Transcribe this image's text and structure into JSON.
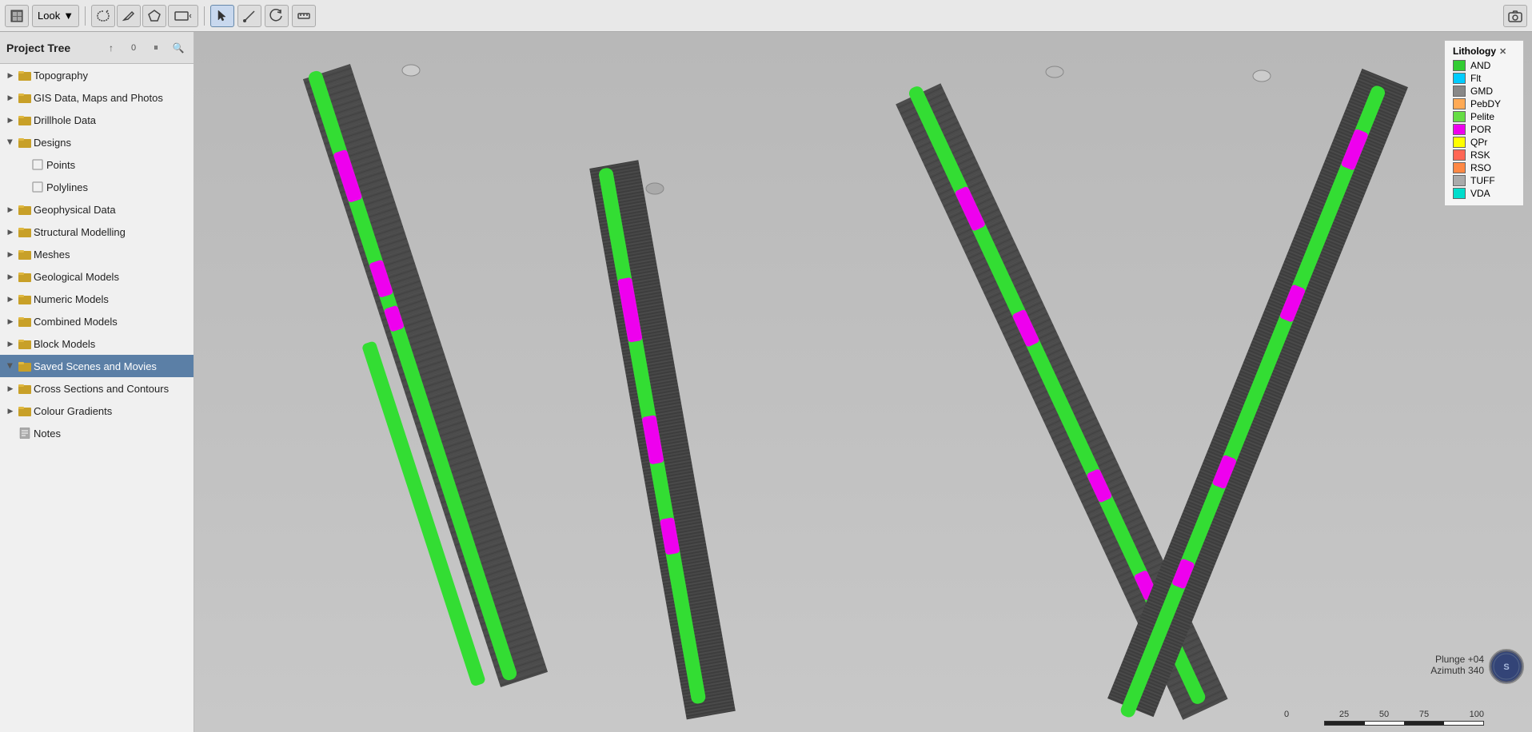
{
  "header": {
    "title": "Project Tree",
    "buttons": [
      "up-arrow",
      "zero",
      "pause",
      "search"
    ]
  },
  "toolbar": {
    "view_icon": "⬛",
    "look_label": "Look",
    "tools": [
      {
        "name": "lasso-draw",
        "icon": "✏"
      },
      {
        "name": "pencil-tool",
        "icon": "✒"
      },
      {
        "name": "polygon-tool",
        "icon": "⬡"
      },
      {
        "name": "rect-tool",
        "icon": "▭"
      },
      {
        "name": "select-tool",
        "icon": "↖"
      },
      {
        "name": "line-tool",
        "icon": "/"
      },
      {
        "name": "rotate-tool",
        "icon": "↻"
      },
      {
        "name": "measure-tool",
        "icon": "📏"
      }
    ],
    "camera_icon": "📷"
  },
  "sidebar": {
    "items": [
      {
        "id": "topography",
        "label": "Topography",
        "type": "folder",
        "expanded": false,
        "indent": 0
      },
      {
        "id": "gis-data",
        "label": "GIS Data, Maps and Photos",
        "type": "folder",
        "expanded": false,
        "indent": 0
      },
      {
        "id": "drillhole-data",
        "label": "Drillhole Data",
        "type": "folder",
        "expanded": false,
        "indent": 0
      },
      {
        "id": "designs",
        "label": "Designs",
        "type": "folder",
        "expanded": true,
        "indent": 0
      },
      {
        "id": "points",
        "label": "Points",
        "type": "item",
        "expanded": false,
        "indent": 1
      },
      {
        "id": "polylines",
        "label": "Polylines",
        "type": "item",
        "expanded": false,
        "indent": 1
      },
      {
        "id": "geophysical-data",
        "label": "Geophysical Data",
        "type": "folder",
        "expanded": false,
        "indent": 0
      },
      {
        "id": "structural-modelling",
        "label": "Structural Modelling",
        "type": "folder",
        "expanded": false,
        "indent": 0
      },
      {
        "id": "meshes",
        "label": "Meshes",
        "type": "folder",
        "expanded": false,
        "indent": 0
      },
      {
        "id": "geological-models",
        "label": "Geological Models",
        "type": "folder",
        "expanded": false,
        "indent": 0
      },
      {
        "id": "numeric-models",
        "label": "Numeric Models",
        "type": "folder",
        "expanded": false,
        "indent": 0
      },
      {
        "id": "combined-models",
        "label": "Combined Models",
        "type": "folder",
        "expanded": false,
        "indent": 0
      },
      {
        "id": "block-models",
        "label": "Block Models",
        "type": "folder",
        "expanded": false,
        "indent": 0
      },
      {
        "id": "saved-scenes",
        "label": "Saved Scenes and Movies",
        "type": "folder",
        "expanded": true,
        "indent": 0,
        "selected": true
      },
      {
        "id": "cross-sections",
        "label": "Cross Sections and Contours",
        "type": "folder",
        "expanded": false,
        "indent": 0
      },
      {
        "id": "colour-gradients",
        "label": "Colour Gradients",
        "type": "folder",
        "expanded": false,
        "indent": 0
      },
      {
        "id": "notes",
        "label": "Notes",
        "type": "note",
        "expanded": false,
        "indent": 0
      }
    ]
  },
  "legend": {
    "title": "Lithology",
    "items": [
      {
        "label": "AND",
        "color": "#33cc33"
      },
      {
        "label": "Flt",
        "color": "#00ccff"
      },
      {
        "label": "GMD",
        "color": "#888888"
      },
      {
        "label": "PebDY",
        "color": "#ffaa55"
      },
      {
        "label": "Pelite",
        "color": "#66dd44"
      },
      {
        "label": "POR",
        "color": "#ee00ee"
      },
      {
        "label": "QPr",
        "color": "#ffff00"
      },
      {
        "label": "RSK",
        "color": "#ff6655"
      },
      {
        "label": "RSO",
        "color": "#ff8844"
      },
      {
        "label": "TUFF",
        "color": "#aaaaaa"
      },
      {
        "label": "VDA",
        "color": "#00ddcc"
      }
    ]
  },
  "orientation": {
    "plunge_label": "Plunge  +04",
    "azimuth_label": "Azimuth  340"
  },
  "scale": {
    "segments": [
      "0",
      "25",
      "50",
      "75",
      "100"
    ]
  }
}
